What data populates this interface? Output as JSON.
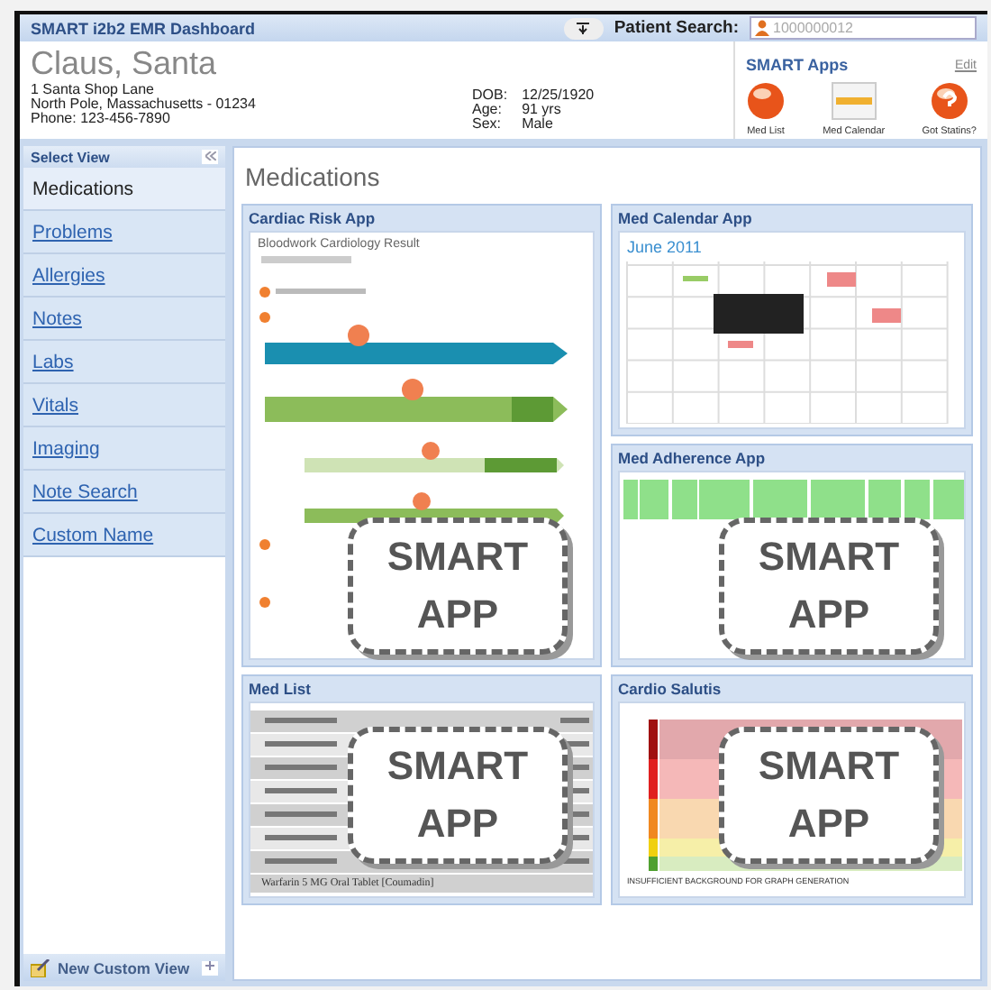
{
  "header": {
    "title": "SMART i2b2 EMR Dashboard",
    "search_label": "Patient Search:",
    "search_placeholder": "1000000012"
  },
  "patient": {
    "name": "Claus, Santa",
    "address": [
      "1 Santa Shop Lane",
      "North Pole, Massachusetts - 01234",
      "Phone: 123-456-7890"
    ],
    "demographics": [
      {
        "label": "DOB:",
        "value": "12/25/1920"
      },
      {
        "label": "Age:",
        "value": "91 yrs"
      },
      {
        "label": "Sex:",
        "value": "Male"
      }
    ]
  },
  "smart_apps": {
    "title": "SMART Apps",
    "edit": "Edit",
    "apps": [
      {
        "label": "Med List",
        "kind": "orb"
      },
      {
        "label": "Med Calendar",
        "kind": "calendar"
      },
      {
        "label": "Got Statins?",
        "kind": "question"
      }
    ]
  },
  "sidebar": {
    "title": "Select View",
    "items": [
      {
        "label": "Medications",
        "selected": true
      },
      {
        "label": "Problems",
        "selected": false
      },
      {
        "label": "Allergies",
        "selected": false
      },
      {
        "label": "Notes",
        "selected": false
      },
      {
        "label": "Labs",
        "selected": false
      },
      {
        "label": "Vitals",
        "selected": false
      },
      {
        "label": "Imaging",
        "selected": false
      },
      {
        "label": "Note Search",
        "selected": false
      },
      {
        "label": "Custom Name",
        "selected": false
      }
    ],
    "footer": "New Custom View"
  },
  "main": {
    "title": "Medications",
    "apps": [
      {
        "title": "Cardiac Risk App",
        "kind": "cardiac",
        "caption": "Bloodwork Cardiology Result",
        "overlay": "SMART APP"
      },
      {
        "title": "Med Calendar App",
        "kind": "calendar",
        "caption": "June 2011"
      },
      {
        "title": "Med Adherence App",
        "kind": "adherence",
        "overlay": "SMART APP"
      },
      {
        "title": "Med List",
        "kind": "medlist",
        "caption": "Warfarin 5 MG Oral Tablet [Coumadin]",
        "overlay": "SMART APP"
      },
      {
        "title": "Cardio Salutis",
        "kind": "salutis",
        "caption": "INSUFFICIENT BACKGROUND FOR GRAPH GENERATION",
        "overlay": "SMART APP"
      }
    ]
  }
}
